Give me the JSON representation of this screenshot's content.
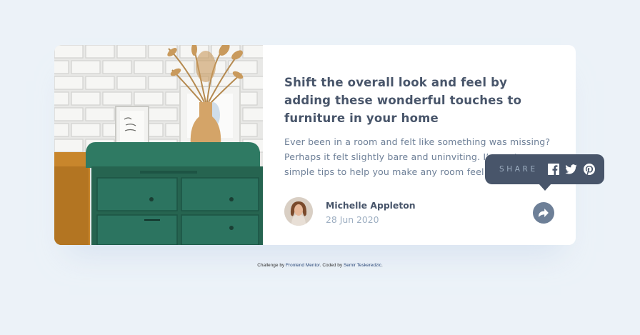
{
  "article": {
    "title": "Shift the overall look and feel by adding these wonderful touches to furniture in your home",
    "description": "Ever been in a room and felt like something was missing? Perhaps it felt slightly bare and uninviting. I’ve got some simple tips to help you make any room feel complete."
  },
  "author": {
    "name": "Michelle Appleton",
    "date": "28 Jun 2020"
  },
  "share": {
    "label": "SHARE",
    "icons": [
      "facebook-icon",
      "twitter-icon",
      "pinterest-icon",
      "share-arrow-icon"
    ]
  },
  "attribution": {
    "prefix": "Challenge by",
    "link1": "Frontend Mentor",
    "middle": ". Coded by",
    "link2": "Semir Teskeredzic",
    "suffix": "."
  },
  "colors": {
    "background": "#ecf2f8",
    "dark_blue": "#48556a",
    "grayish_blue": "#6d7f97",
    "light_grayish_blue": "#9eafc2"
  }
}
